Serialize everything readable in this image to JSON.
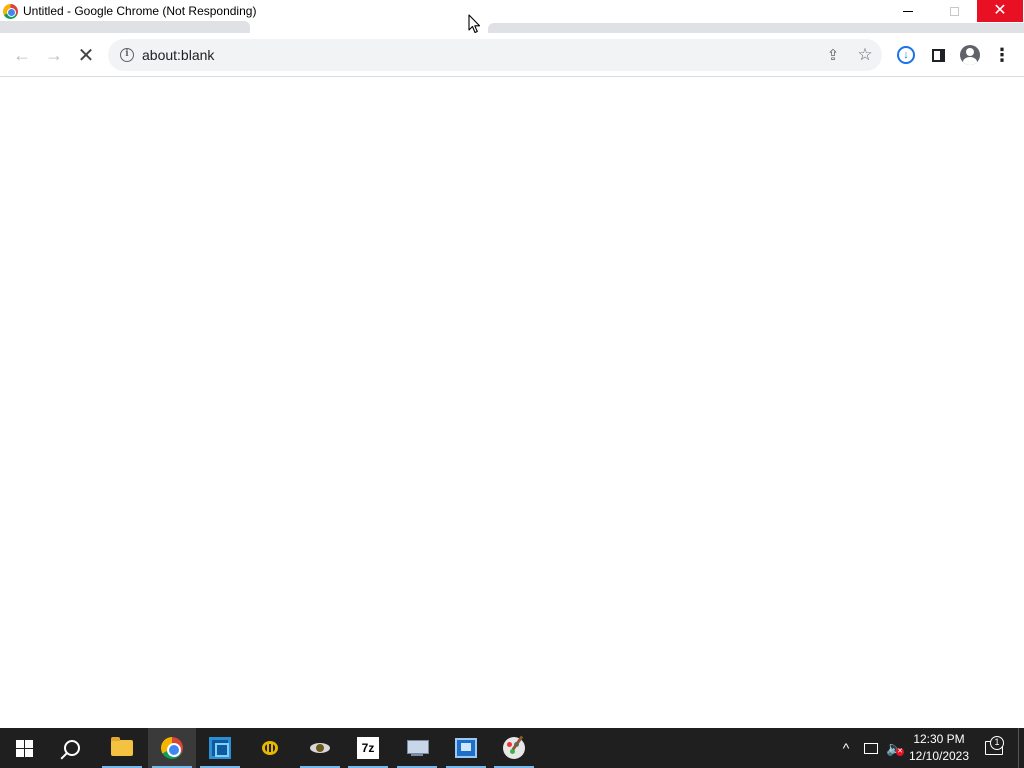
{
  "window": {
    "title": "Untitled - Google Chrome (Not Responding)",
    "close_glyph": "✕"
  },
  "toolbar": {
    "back_glyph": "←",
    "forward_glyph": "→",
    "stop_glyph": "✕",
    "address": "about:blank",
    "info_glyph": "i",
    "share_glyph": "⇪",
    "star_glyph": "☆",
    "download_glyph": "↓",
    "menu_glyph": "⋮"
  },
  "taskbar": {
    "apps": [
      {
        "name": "start",
        "icon": "windows-logo-icon"
      },
      {
        "name": "search",
        "icon": "search-icon"
      },
      {
        "name": "file-explorer",
        "icon": "folder-icon"
      },
      {
        "name": "google-chrome",
        "icon": "chrome-icon",
        "active": true
      },
      {
        "name": "virtualbox",
        "icon": "virtualbox-icon"
      },
      {
        "name": "yellow-app",
        "icon": "bee-icon"
      },
      {
        "name": "wasp-app",
        "icon": "wasp-icon"
      },
      {
        "name": "7zip",
        "icon": "7zip-icon",
        "label": "7z"
      },
      {
        "name": "network-drive",
        "icon": "network-drive-icon"
      },
      {
        "name": "remote-desktop",
        "icon": "remote-desktop-icon"
      },
      {
        "name": "paint",
        "icon": "paint-icon"
      }
    ],
    "tray": {
      "chevron_glyph": "^",
      "speaker_glyph": "🔈",
      "time": "12:30 PM",
      "date": "12/10/2023",
      "notification_count": "1"
    }
  }
}
